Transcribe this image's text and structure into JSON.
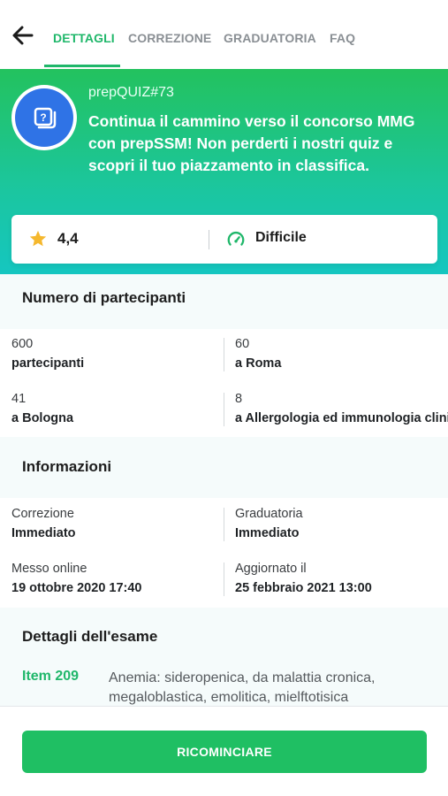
{
  "nav": {
    "tabs": [
      {
        "label": "DETTAGLI",
        "active": true
      },
      {
        "label": "CORREZIONE",
        "active": false
      },
      {
        "label": "GRADUATORIA",
        "active": false
      },
      {
        "label": "FAQ",
        "active": false
      }
    ],
    "back_icon": "arrow-left-icon"
  },
  "hero": {
    "quiz_id": "prepQUIZ#73",
    "description": "Continua il cammino verso il concorso MMG con prepSSM! Non perderti i nostri quiz e scopri il tuo piazzamento in classifica.",
    "icon": "quiz-cards-icon",
    "icon_color": "#2f73e6"
  },
  "rating": {
    "value": "4,4",
    "difficulty": "Difficile",
    "star_color": "#f5b82e",
    "accent": "#1fb76a"
  },
  "participants": {
    "title": "Numero di partecipanti",
    "cells": [
      {
        "label": "600",
        "value": "partecipanti"
      },
      {
        "label": "60",
        "value": "a Roma"
      },
      {
        "label": "41",
        "value": "a Bologna"
      },
      {
        "label": "8",
        "value": "a Allergologia ed immunologia clinica"
      }
    ]
  },
  "info": {
    "title": "Informazioni",
    "cells": [
      {
        "label": "Correzione",
        "value": "Immediato"
      },
      {
        "label": "Graduatoria",
        "value": "Immediato"
      },
      {
        "label": "Messo online",
        "value": "19 ottobre 2020 17:40"
      },
      {
        "label": "Aggiornato il",
        "value": "25 febbraio 2021 13:00"
      }
    ]
  },
  "exam": {
    "title": "Dettagli dell'esame",
    "items": [
      {
        "code": "Item 209",
        "text": "Anemia: sideropenica, da malattia cronica, megaloblastica, emolitica, mielftotisica"
      }
    ]
  },
  "cta": {
    "label": "RICOMINCIARE",
    "color": "#1fbf63"
  }
}
